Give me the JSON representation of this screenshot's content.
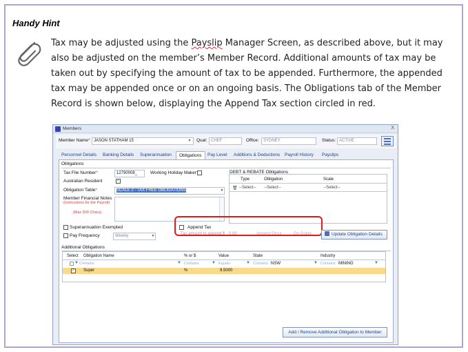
{
  "hint": {
    "title": "Handy Hint",
    "text_before": "Tax may be adjusted using the ",
    "text_squiggle": "Payslip",
    "text_after": " Manager Screen, as described above, but it may also be adjusted on the member’s Member Record. Additional amounts of tax may be taken out by specifying the amount of tax to be appended. Furthermore, the appended tax may be appended once or on an ongoing basis. The Obligations tab of the Member Record is shown below, displaying the Append Tax section circled in red."
  },
  "window": {
    "title": "Members",
    "close": "X",
    "member_label": "Member Name",
    "member_value": "JASON STATHAM 15",
    "qual_label": "Qual:",
    "qual_value": "CHEF",
    "office_label": "Office:",
    "office_value": "SYDNEY",
    "status_label": "Status:",
    "status_value": "ACTIVE"
  },
  "tabs": [
    {
      "label": "Personnel Details"
    },
    {
      "label": "Banking Details"
    },
    {
      "label": "Superannuation"
    },
    {
      "label": "Obligations"
    },
    {
      "label": "Pay Level"
    },
    {
      "label": "Additions & Deductions"
    },
    {
      "label": "Payroll History"
    },
    {
      "label": "Payslips"
    }
  ],
  "obligations": {
    "section": "Obligations",
    "tfn_label": "Tax File Number",
    "tfn_value": "12790008_",
    "whm_label": "Working Holiday Maker?",
    "resident_label": "Australian Resident",
    "table_label": "Obligation Table",
    "table_value": "SCALE 2 - TAX FREE OBLIGATIONS",
    "notes_label": "Member Financial Notes",
    "notes_hint": "(Instructions for the Payroll)",
    "notes_max": "(Max 500 Chars)",
    "super_exempt_label": "Superannuation Exempted",
    "pay_freq_label": "Pay Frequency",
    "pay_freq_value": "Weekly",
    "append_tax_label": "Append Tax",
    "append_amount_label": "Tax amount to append $",
    "append_amount_value": "0.00",
    "append_once": "Append Once",
    "on_going": "On Going",
    "update_btn": "Update Obligation Details"
  },
  "debt": {
    "title": "DEBT & REBATE Obligations",
    "columns": [
      "Type",
      "Obligation",
      "Scale"
    ],
    "row": [
      "--Select--",
      "--Select--",
      "--Select--"
    ]
  },
  "additional": {
    "title": "Additional Obligations",
    "columns": [
      "Select",
      "Obligation Name",
      "% or $",
      "Value",
      "State",
      "Industry"
    ],
    "filters": [
      "Contains",
      "Contains",
      "Equals",
      "Contains",
      "Contains"
    ],
    "filter_state": "NSW",
    "filter_industry": "MINING",
    "row": {
      "name": "Super",
      "type": "%",
      "value": "9.5000"
    },
    "add_btn": "Add / Remove Additional  Obligation to Member"
  }
}
